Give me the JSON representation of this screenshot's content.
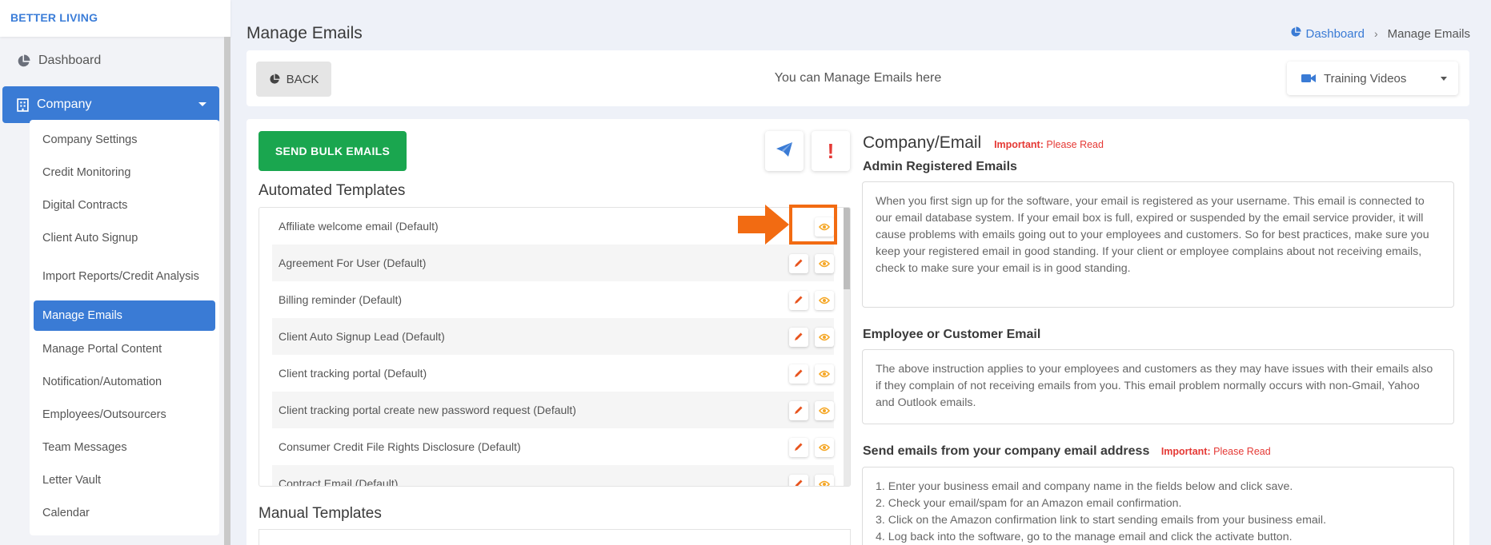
{
  "brand": "BETTER LIVING",
  "sidebar": {
    "dashboard_label": "Dashboard",
    "company_label": "Company",
    "submenu": [
      {
        "label": "Company Settings"
      },
      {
        "label": "Credit Monitoring"
      },
      {
        "label": "Digital Contracts"
      },
      {
        "label": "Client Auto Signup"
      },
      {
        "label": "Import Reports/Credit Analysis"
      },
      {
        "label": "Manage Emails"
      },
      {
        "label": "Manage Portal Content"
      },
      {
        "label": "Notification/Automation"
      },
      {
        "label": "Employees/Outsourcers"
      },
      {
        "label": "Team Messages"
      },
      {
        "label": "Letter Vault"
      },
      {
        "label": "Calendar"
      }
    ]
  },
  "header": {
    "title": "Manage Emails",
    "breadcrumb": {
      "home": "Dashboard",
      "current": "Manage Emails"
    }
  },
  "topbar": {
    "back_label": "BACK",
    "message": "You can Manage Emails here",
    "training_label": "Training Videos"
  },
  "main": {
    "bulk_button": "SEND BULK EMAILS",
    "automated_title": "Automated Templates",
    "manual_title": "Manual Templates",
    "templates": [
      {
        "name": "Affiliate welcome email (Default)",
        "editable": false
      },
      {
        "name": "Agreement For User (Default)",
        "editable": true
      },
      {
        "name": "Billing reminder (Default)",
        "editable": true
      },
      {
        "name": "Client Auto Signup Lead (Default)",
        "editable": true
      },
      {
        "name": "Client tracking portal (Default)",
        "editable": true
      },
      {
        "name": "Client tracking portal create new password request (Default)",
        "editable": true
      },
      {
        "name": "Consumer Credit File Rights Disclosure (Default)",
        "editable": true
      },
      {
        "name": "Contract Email (Default)",
        "editable": true
      }
    ]
  },
  "right": {
    "title": "Company/Email",
    "important_label": "Important:",
    "important_text": "Please Read",
    "admin_title": "Admin Registered Emails",
    "admin_text": "When you first sign up for the software, your email is registered as your username. This email is connected to our email database system. If your email box is full, expired or suspended by the email service provider, it will cause problems with emails going out to your employees and customers. So for best practices, make sure you keep your registered email in good standing. If your client or employee complains about not receiving emails, check to make sure your email is in good standing.",
    "employee_title": "Employee or Customer Email",
    "employee_text": "The above instruction applies to your employees and customers as they may have issues with their emails also if they complain of not receiving emails from you. This email problem normally occurs with non-Gmail, Yahoo and Outlook emails.",
    "send_title": "Send emails from your company email address",
    "steps": [
      "1. Enter your business email and company name in the fields below and click save.",
      "2. Check your email/spam for an Amazon email confirmation.",
      "3. Click on the Amazon confirmation link to start sending emails from your business email.",
      "4. Log back into the software, go to the manage email and click the activate button."
    ]
  },
  "colors": {
    "primary": "#3a7bd5",
    "success": "#1aa64f",
    "accent": "#f26b12",
    "danger": "#e53935",
    "eye": "#f5a623"
  },
  "icons": {
    "dashboard": "pie-chart-icon",
    "company": "building-icon",
    "back": "pie-chart-icon",
    "training": "video-camera-icon",
    "send": "paper-plane-icon",
    "alert": "exclamation-icon",
    "edit": "pencil-icon",
    "view": "eye-icon",
    "pointer": "arrow-right-icon"
  }
}
